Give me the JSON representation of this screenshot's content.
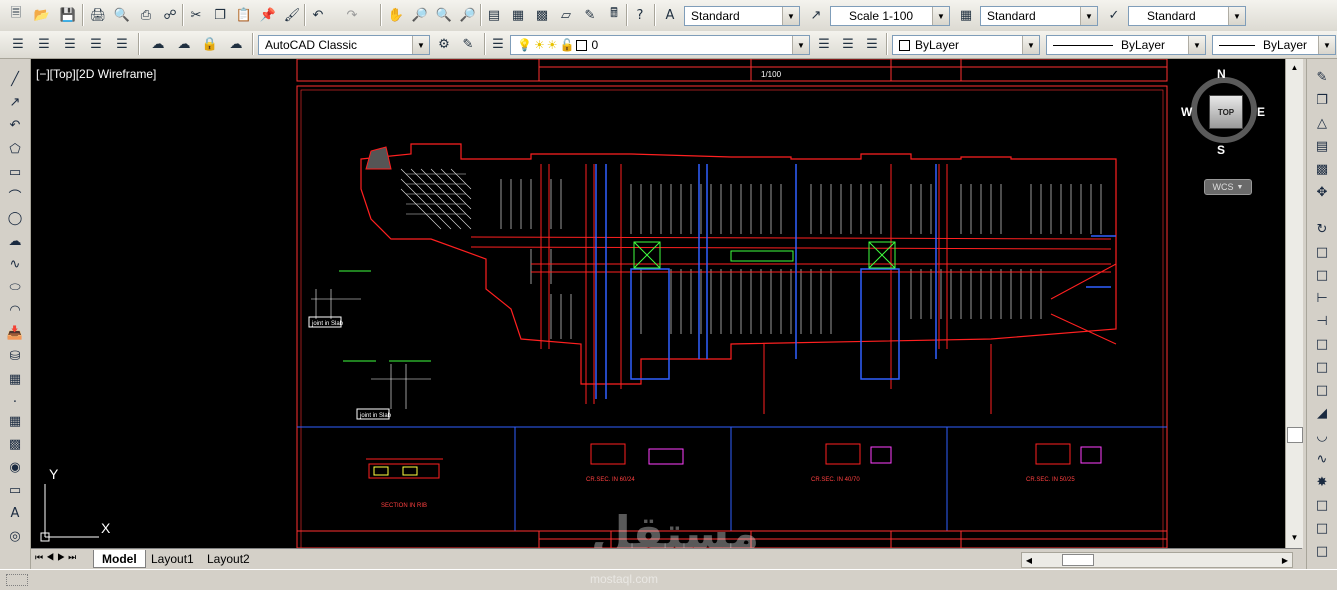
{
  "toolbar1": {
    "text_style": "Standard",
    "dim_style": "Scale 1-100",
    "table_style": "Standard",
    "multileader_style": "Standard"
  },
  "toolbar2": {
    "workspace": "AutoCAD Classic",
    "layer": "0",
    "color": "ByLayer",
    "linetype": "ByLayer",
    "lineweight": "ByLayer"
  },
  "viewport": {
    "label": "[−][Top][2D Wireframe]"
  },
  "viewcube": {
    "north": "N",
    "south": "S",
    "east": "E",
    "west": "W",
    "face": "TOP",
    "wcs": "WCS"
  },
  "ucs": {
    "x": "X",
    "y": "Y"
  },
  "drawing": {
    "scale_text": "1/100",
    "section_rib": "SECTION IN RIB",
    "cr_sec_1": "CR.SEC. IN 60/24",
    "cr_sec_2": "CR.SEC. IN 40/70",
    "cr_sec_3": "CR.SEC. IN 50/25",
    "joint_detail_1": "joint in Slab",
    "joint_detail_2": "joint in Slab"
  },
  "tabs": [
    {
      "label": "Model"
    },
    {
      "label": "Layout1"
    },
    {
      "label": "Layout2"
    }
  ],
  "watermark": {
    "brand": "مستقل",
    "site": "mostaql.com"
  }
}
